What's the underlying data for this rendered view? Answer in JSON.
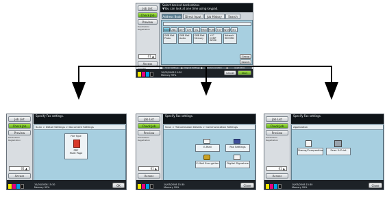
{
  "panel_top": {
    "sidebar": {
      "job_list": "Job List",
      "check_job": "Check Job",
      "preview": "Preview",
      "small_text": "Destination\nRegistration",
      "number": "01  ▲",
      "access": "Access",
      "shorter": "Counter\nStatus"
    },
    "message": "Select desired destinations.\n▼You can look at one time using keypad.",
    "tabs": [
      "Address Book",
      "Direct Input",
      "Job History",
      "Search"
    ],
    "keys": [
      "Index",
      "ABC",
      "DEF",
      "GHI",
      "JKL",
      "MNO",
      "PQRS",
      "TUV",
      "WXYZ",
      "etc"
    ],
    "addresses": [
      "SMB Mail\nPhoto",
      "SMB Mail\nAudio",
      "SMB Mail\nMemory",
      "+FC COMP\nWORK",
      "Network\nRECORD"
    ],
    "side_buttons": [
      "Group",
      "Search"
    ],
    "bottom_buttons": [
      "Scan\nSettings",
      "Original\nSettings",
      "Communication\nSettings",
      "Application"
    ],
    "cancel_label": "Cancel",
    "start_label": "Start",
    "status": "10/05/2008    15:30\nMemory        99%"
  },
  "panel_left": {
    "message": "Specify Fax settings.",
    "title": "Scan > Detail Settings > Document Settings",
    "tile_title": "File Type",
    "tile_value": "PDF\nMulti Page",
    "ok_label": "OK",
    "status": "10/05/2008    15:30\nMemory        99%"
  },
  "panel_mid": {
    "message": "Specify Fax settings.",
    "title": "Scan > Transmission Details > Communication Settings",
    "items": [
      "E-Mail",
      "Fax Settings",
      "E-Mail Encryption",
      "Digital Signature"
    ],
    "close_label": "Close",
    "status": "10/05/2008    15:30\nMemory        99%"
  },
  "panel_right": {
    "message": "Specify Fax settings.",
    "title": "Application",
    "items": [
      "Stamp/Composition",
      "Scan & Print"
    ],
    "close_label": "Close",
    "status": "10/05/2008    15:30\nMemory        99%"
  },
  "colors": {
    "green": "#6cbf22",
    "content": "#a7cfe0",
    "bar": "#1d2227"
  }
}
